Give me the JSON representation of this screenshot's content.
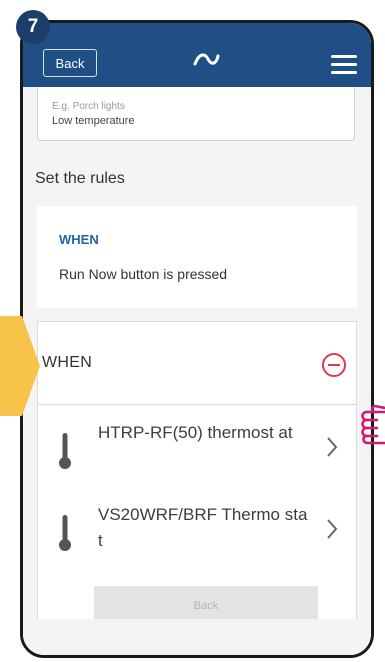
{
  "step": {
    "number": "7"
  },
  "header": {
    "back_label": "Back"
  },
  "name_field": {
    "placeholder": "E.g. Porch lights",
    "value": "Low temperature"
  },
  "rules": {
    "title": "Set the rules"
  },
  "when_card": {
    "label": "WHEN",
    "text": "Run Now button is pressed"
  },
  "when_panel": {
    "title": "WHEN",
    "items": [
      {
        "label": "HTRP-RF(50) thermost at",
        "icon": "thermometer-icon"
      },
      {
        "label": "VS20WRF/BRF Thermo stat",
        "icon": "thermometer-icon"
      }
    ],
    "back_label": "Back"
  },
  "colors": {
    "header": "#1f4f84",
    "accent_blue": "#2563a8",
    "remove_red": "#e03a4a",
    "pointer_yellow": "#f8c34a",
    "hand_magenta": "#d3186f"
  }
}
